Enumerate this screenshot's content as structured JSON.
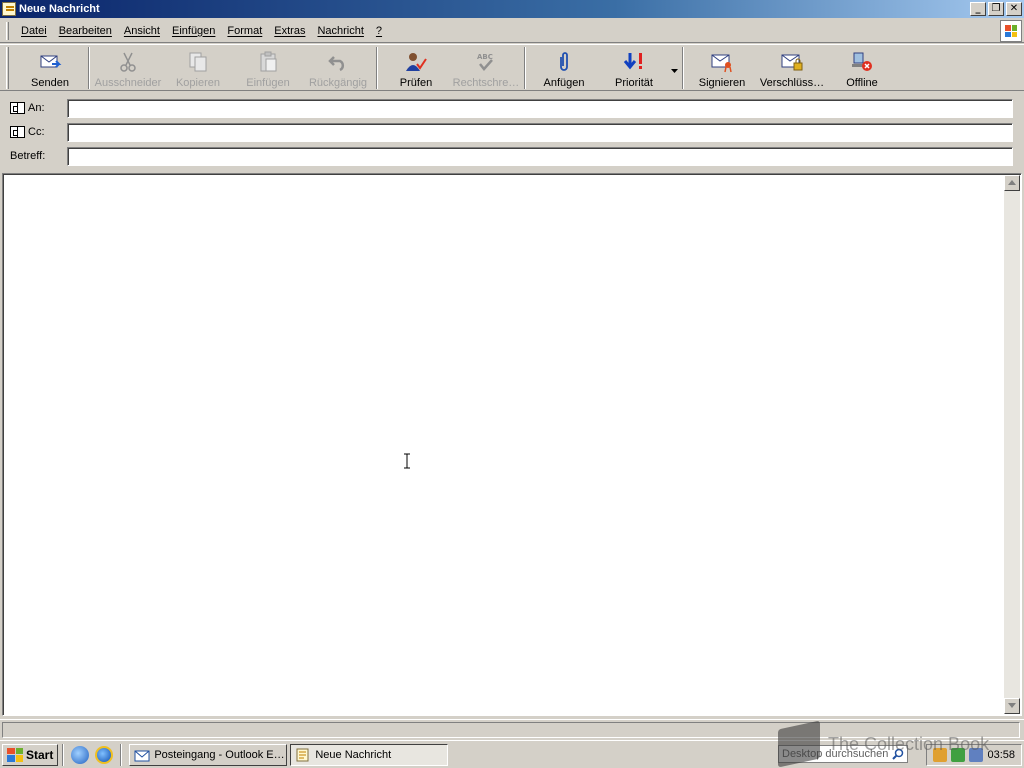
{
  "window": {
    "title": "Neue Nachricht",
    "controls": {
      "minimize": "_",
      "restore": "❐",
      "close": "✕"
    }
  },
  "menu": [
    "Datei",
    "Bearbeiten",
    "Ansicht",
    "Einfügen",
    "Format",
    "Extras",
    "Nachricht",
    "?"
  ],
  "toolbar": {
    "buttons": [
      {
        "label": "Senden",
        "icon": "send-icon",
        "enabled": true
      },
      {
        "label": "Ausschneider",
        "icon": "scissors-icon",
        "enabled": false
      },
      {
        "label": "Kopieren",
        "icon": "copy-icon",
        "enabled": false
      },
      {
        "label": "Einfügen",
        "icon": "paste-icon",
        "enabled": false
      },
      {
        "label": "Rückgängig",
        "icon": "undo-icon",
        "enabled": false
      },
      {
        "label": "Prüfen",
        "icon": "check-names-icon",
        "enabled": true
      },
      {
        "label": "Rechtschre…",
        "icon": "spelling-icon",
        "enabled": false
      },
      {
        "label": "Anfügen",
        "icon": "paperclip-icon",
        "enabled": true
      },
      {
        "label": "Priorität",
        "icon": "priority-icon",
        "enabled": true
      },
      {
        "label": "Signieren",
        "icon": "sign-icon",
        "enabled": true
      },
      {
        "label": "Verschlüss…",
        "icon": "encrypt-icon",
        "enabled": true
      },
      {
        "label": "Offline",
        "icon": "offline-icon",
        "enabled": true
      }
    ]
  },
  "fields": {
    "to": {
      "label": "An:",
      "value": ""
    },
    "cc": {
      "label": "Cc:",
      "value": ""
    },
    "subject": {
      "label": "Betreff:",
      "value": ""
    }
  },
  "body": {
    "text": ""
  },
  "taskbar": {
    "start_label": "Start",
    "tasks": [
      {
        "label": "Posteingang - Outlook E…",
        "active": false
      },
      {
        "label": "Neue Nachricht",
        "active": true
      }
    ],
    "search_placeholder": "Desktop durchsuchen",
    "clock": "03:58"
  },
  "watermark": "The Collection Book",
  "colors": {
    "titlebar_start": "#0a246a",
    "titlebar_end": "#a6caf0",
    "chrome": "#d4d0c8"
  }
}
